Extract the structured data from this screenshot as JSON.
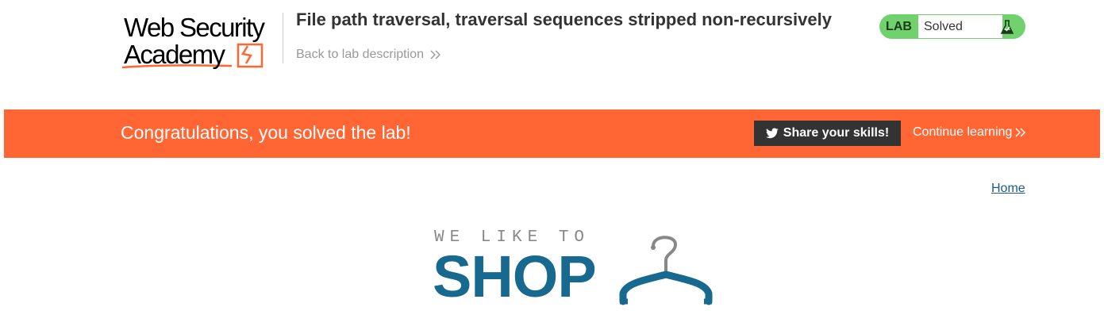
{
  "header": {
    "logo_line1": "Web Security",
    "logo_line2": "Academy",
    "lab_title": "File path traversal, traversal sequences stripped non-recursively",
    "back_link": "Back to lab description",
    "status": {
      "tag": "LAB",
      "text": "Solved",
      "color": "#70d16d"
    }
  },
  "banner": {
    "message": "Congratulations, you solved the lab!",
    "share_label": "Share your skills!",
    "continue_label": "Continue learning",
    "color": "#ff6633"
  },
  "nav": {
    "home": "Home"
  },
  "shop_logo": {
    "tagline": "WE LIKE TO",
    "word": "SHOP",
    "color": "#17698f"
  },
  "icons": [
    "academy-logo-icon",
    "chevron-right-double-icon",
    "flask-icon",
    "twitter-icon",
    "hanger-icon"
  ]
}
